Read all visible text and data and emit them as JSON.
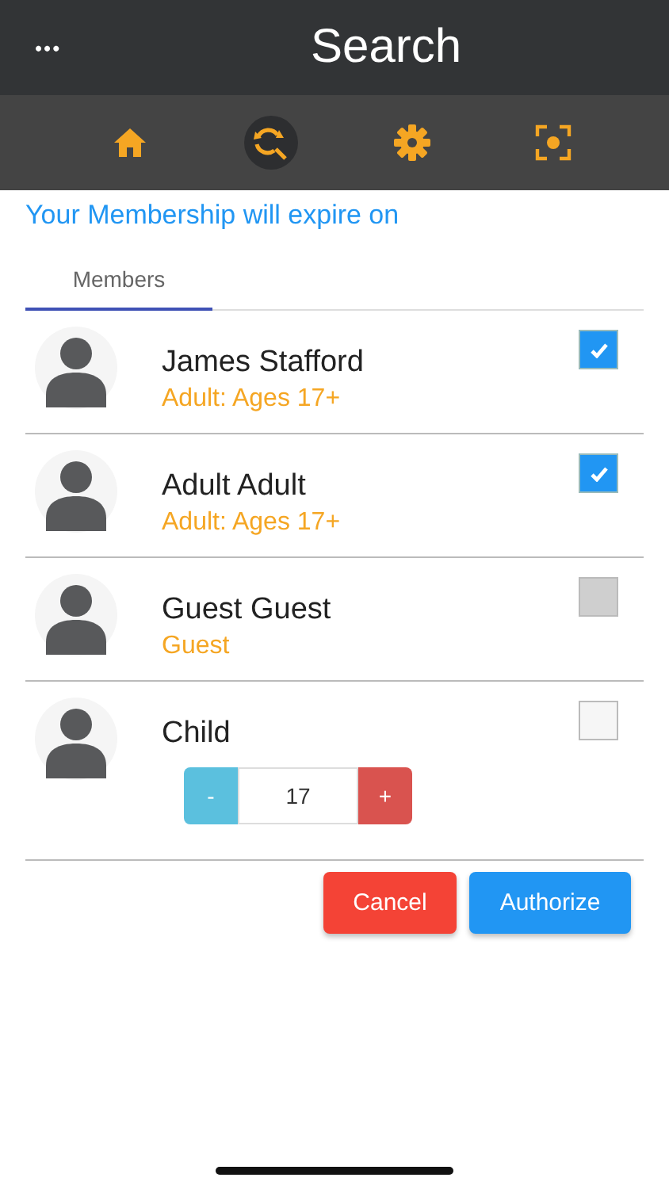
{
  "header": {
    "menu": "•••",
    "title": "Search"
  },
  "toolbar": [
    {
      "kind": "home",
      "selected": false
    },
    {
      "kind": "search",
      "selected": true
    },
    {
      "kind": "settings",
      "selected": false
    },
    {
      "kind": "scan",
      "selected": false
    }
  ],
  "notice": "Your Membership will expire on",
  "tabs": [
    {
      "label": "Members",
      "selected": true
    }
  ],
  "members": [
    {
      "name": "James Stafford",
      "type": "Adult: Ages 17+",
      "checked": true,
      "disabled": false
    },
    {
      "name": "Adult Adult",
      "type": "Adult: Ages 17+",
      "checked": true,
      "disabled": false
    },
    {
      "name": "Guest Guest",
      "type": "Guest",
      "checked": false,
      "disabled": true
    },
    {
      "name": "Child",
      "checked": false,
      "disabled": false,
      "stepper": {
        "minus": "-",
        "value": "17",
        "plus": "+"
      }
    }
  ],
  "buttons": [
    {
      "label": "Cancel",
      "kind": "cancel"
    },
    {
      "label": "Authorize",
      "kind": "primary"
    }
  ]
}
